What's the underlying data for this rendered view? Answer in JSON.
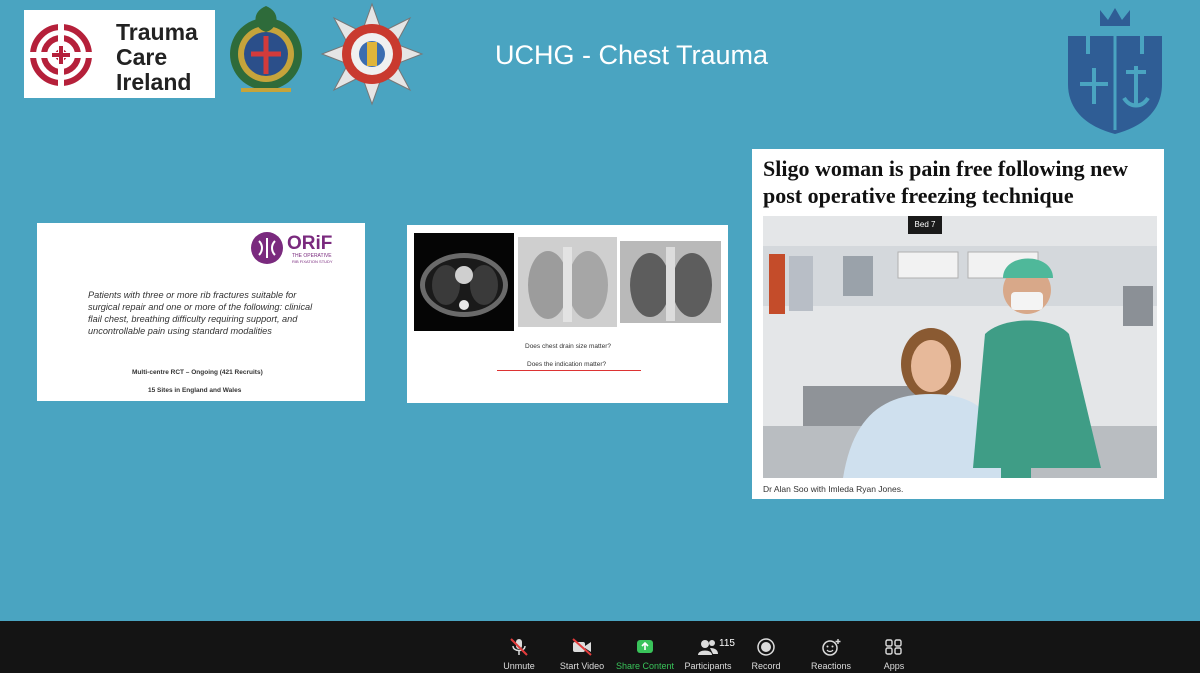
{
  "slide": {
    "logo_text": [
      "Trauma",
      "Care",
      "Ireland"
    ],
    "title": "UCHG - Chest Trauma"
  },
  "orif_card": {
    "logo_word": "ORiF",
    "logo_sub1": "THE OPERATIVE",
    "logo_sub2": "RIB FIXATION STUDY",
    "description": "Patients with three or more rib fractures suitable for surgical repair and one or more of the following: clinical flail chest, breathing difficulty requiring support, and uncontrollable pain using standard modalities",
    "study_line": "Multi-centre RCT – Ongoing (421 Recruits)",
    "sites_line": "15 Sites in England and Wales"
  },
  "xray_card": {
    "question1": "Does chest drain size matter?",
    "question2": "Does the indication matter?"
  },
  "news_card": {
    "headline": "Sligo woman is pain free following new post operative freezing technique",
    "bed_sign": "Bed 7",
    "caption": "Dr Alan Soo with Imleda Ryan Jones."
  },
  "toolbar": {
    "unmute": "Unmute",
    "start_video": "Start Video",
    "share_content": "Share Content",
    "participants": "Participants",
    "participants_count": "115",
    "record": "Record",
    "reactions": "Reactions",
    "apps": "Apps"
  },
  "colors": {
    "slide_bg": "#4aa4c1",
    "toolbar_bg": "#141414",
    "share_green": "#39c35a",
    "logo_red": "#b5203a",
    "shield_blue": "#2f5d95"
  }
}
